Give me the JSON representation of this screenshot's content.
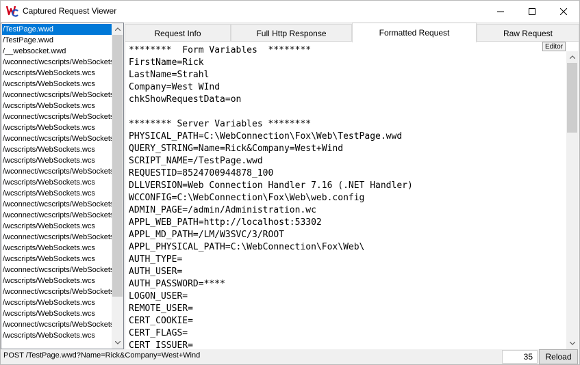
{
  "window": {
    "title": "Captured Request Viewer",
    "icon": "wc-logo-icon"
  },
  "request_list": {
    "items": [
      "/TestPage.wwd",
      "/TestPage.wwd",
      "/__websocket.wwd",
      "/wconnect/wcscripts/WebSockets.wcs",
      "/wcscripts/WebSockets.wcs",
      "/wcscripts/WebSockets.wcs",
      "/wconnect/wcscripts/WebSockets.wcs",
      "/wcscripts/WebSockets.wcs",
      "/wconnect/wcscripts/WebSockets.wcs",
      "/wcscripts/WebSockets.wcs",
      "/wconnect/wcscripts/WebSockets.wcs",
      "/wcscripts/WebSockets.wcs",
      "/wcscripts/WebSockets.wcs",
      "/wconnect/wcscripts/WebSockets.wcs",
      "/wcscripts/WebSockets.wcs",
      "/wcscripts/WebSockets.wcs",
      "/wconnect/wcscripts/WebSockets.wcs",
      "/wconnect/wcscripts/WebSockets.wcs",
      "/wcscripts/WebSockets.wcs",
      "/wconnect/wcscripts/WebSockets.wcs",
      "/wcscripts/WebSockets.wcs",
      "/wcscripts/WebSockets.wcs",
      "/wconnect/wcscripts/WebSockets.wcs",
      "/wcscripts/WebSockets.wcs",
      "/wconnect/wcscripts/WebSockets.wcs",
      "/wcscripts/WebSockets.wcs",
      "/wcscripts/WebSockets.wcs",
      "/wconnect/wcscripts/WebSockets.wcs",
      "/wcscripts/WebSockets.wcs"
    ],
    "selected_index": 0
  },
  "tabs": [
    {
      "label": "Request Info"
    },
    {
      "label": "Full Http Response"
    },
    {
      "label": "Formatted Request"
    },
    {
      "label": "Raw Request"
    }
  ],
  "active_tab": "Formatted Request",
  "editor": {
    "badge": "Editor",
    "lines": [
      "********  Form Variables  ********",
      "FirstName=Rick",
      "LastName=Strahl",
      "Company=West WInd",
      "chkShowRequestData=on",
      "",
      "******** Server Variables ********",
      "PHYSICAL_PATH=C:\\WebConnection\\Fox\\Web\\TestPage.wwd",
      "QUERY_STRING=Name=Rick&Company=West+Wind",
      "SCRIPT_NAME=/TestPage.wwd",
      "REQUESTID=8524700944878_100",
      "DLLVERSION=Web Connection Handler 7.16 (.NET Handler)",
      "WCCONFIG=C:\\WebConnection\\Fox\\Web\\web.config",
      "ADMIN_PAGE=/admin/Administration.wc",
      "APPL_WEB_PATH=http://localhost:53302",
      "APPL_MD_PATH=/LM/W3SVC/3/ROOT",
      "APPL_PHYSICAL_PATH=C:\\WebConnection\\Fox\\Web\\",
      "AUTH_TYPE=",
      "AUTH_USER=",
      "AUTH_PASSWORD=****",
      "LOGON_USER=",
      "REMOTE_USER=",
      "CERT_COOKIE=",
      "CERT_FLAGS=",
      "CERT_ISSUER="
    ]
  },
  "statusbar": {
    "request_line": "POST /TestPage.wwd?Name=Rick&Company=West+Wind",
    "count": "35",
    "reload_label": "Reload"
  },
  "colors": {
    "selection": "#0078d7",
    "logo_red": "#d0021b",
    "logo_blue": "#1f4fbf"
  }
}
